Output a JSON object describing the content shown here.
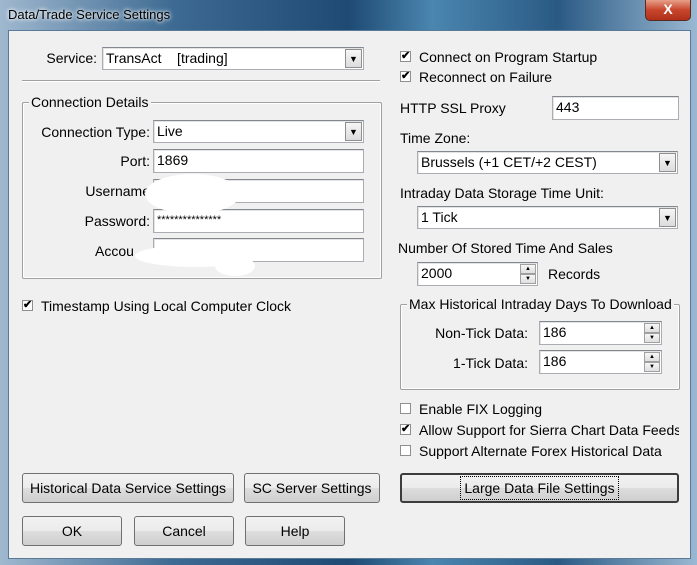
{
  "window": {
    "title": "Data/Trade Service Settings",
    "close_glyph": "X"
  },
  "service": {
    "label": "Service:",
    "value": "TransAct    [trading]"
  },
  "connection": {
    "legend": "Connection Details",
    "type_label": "Connection Type:",
    "type_value": "Live",
    "port_label": "Port:",
    "port_value": "1869",
    "username_label": "Username",
    "username_value": "",
    "password_label": "Password:",
    "password_value": "***************",
    "account_label": "Accou",
    "account_value": ""
  },
  "timestamp": {
    "label": "Timestamp Using Local Computer Clock",
    "checked": true
  },
  "connect_startup": {
    "label": "Connect on Program Startup",
    "checked": true
  },
  "reconnect": {
    "label": "Reconnect on Failure",
    "checked": true
  },
  "http_proxy": {
    "label": "HTTP SSL Proxy",
    "value": "443"
  },
  "time_zone": {
    "label": "Time Zone:",
    "value": "Brussels (+1 CET/+2 CEST)"
  },
  "storage_unit": {
    "label": "Intraday Data Storage Time Unit:",
    "value": "1 Tick"
  },
  "stored_ts": {
    "label": "Number Of Stored Time And Sales",
    "value": "2000",
    "suffix": "Records"
  },
  "max_hist": {
    "legend": "Max Historical Intraday Days To Download",
    "non_tick_label": "Non-Tick Data:",
    "non_tick_value": "186",
    "one_tick_label": "1-Tick Data:",
    "one_tick_value": "186"
  },
  "fix_logging": {
    "label": "Enable FIX Logging",
    "checked": false
  },
  "sierra_feed": {
    "label": "Allow Support for Sierra Chart Data Feeds",
    "checked": true
  },
  "alt_forex": {
    "label": "Support Alternate Forex Historical Data",
    "checked": false
  },
  "buttons": {
    "historical": "Historical Data Service Settings",
    "sc_server": "SC Server Settings",
    "large_file": "Large Data File Settings",
    "ok": "OK",
    "cancel": "Cancel",
    "help": "Help"
  },
  "glyphs": {
    "check": "✔",
    "down": "▼",
    "up_small": "▲",
    "down_small": "▼"
  }
}
